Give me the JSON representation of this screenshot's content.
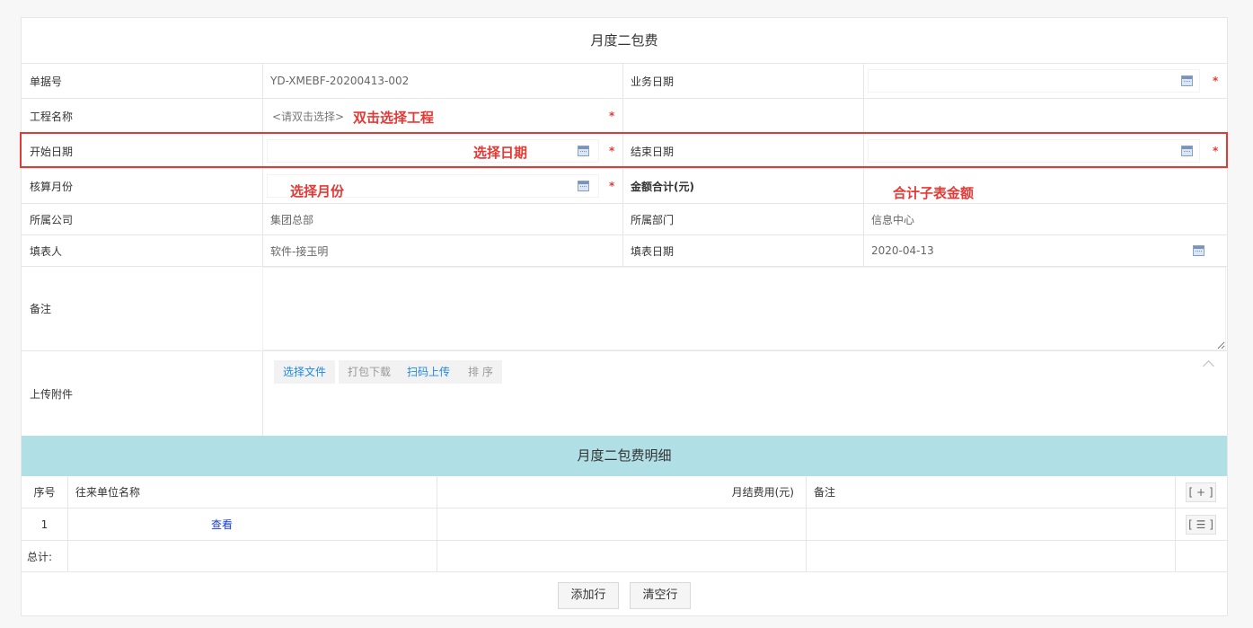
{
  "form": {
    "title": "月度二包费",
    "fields": {
      "doc_no_label": "单据号",
      "doc_no_value": "YD-XMEBF-20200413-002",
      "biz_date_label": "业务日期",
      "project_label": "工程名称",
      "project_placeholder": "<请双击选择>",
      "start_label": "开始日期",
      "end_label": "结束日期",
      "month_label": "核算月份",
      "total_label": "金额合计(元)",
      "company_label": "所属公司",
      "company_value": "集团总部",
      "dept_label": "所属部门",
      "dept_value": "信息中心",
      "filler_label": "填表人",
      "filler_value": "软件-接玉明",
      "fill_date_label": "填表日期",
      "fill_date_value": "2020-04-13",
      "remark_label": "备注",
      "attach_label": "上传附件"
    },
    "required_mark": "*",
    "annotations": {
      "project": "双击选择工程",
      "date": "选择日期",
      "month": "选择月份",
      "total": "合计子表金额"
    },
    "attach_buttons": {
      "choose": "选择文件",
      "pack": "打包下载",
      "scan": "扫码上传",
      "sort": "排 序"
    }
  },
  "detail": {
    "title": "月度二包费明细",
    "columns": {
      "seq": "序号",
      "unit": "往来单位名称",
      "fee": "月结费用(元)",
      "remark": "备注"
    },
    "add_icon": "[ + ]",
    "menu_icon": "[ ☰ ]",
    "rows": [
      {
        "seq": "1",
        "link": "查看"
      }
    ],
    "total_label": "总计:",
    "add_row": "添加行",
    "clear_rows": "清空行"
  },
  "colors": {
    "accent_red": "#e53935",
    "detail_header": "#b0e0e6",
    "link_blue": "#1a3fcc"
  }
}
